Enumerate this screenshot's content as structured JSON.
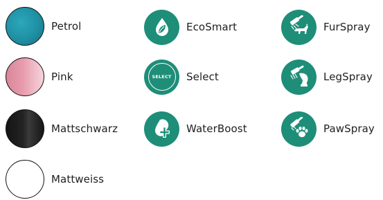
{
  "colors": {
    "petrol": "#1f8fa3",
    "pink": "#e296a7",
    "mattschwarz": "#1c1c1c",
    "mattweiss": "#ffffff",
    "feature_icon_bg": "#1e8e78"
  },
  "color_swatches": [
    {
      "label": "Petrol"
    },
    {
      "label": "Pink"
    },
    {
      "label": "Mattschwarz"
    },
    {
      "label": "Mattweiss"
    }
  ],
  "features": [
    {
      "label": "EcoSmart",
      "icon": "leaf-drop-icon"
    },
    {
      "label": "Select",
      "icon": "select-badge-icon",
      "icon_text": "SELECT"
    },
    {
      "label": "WaterBoost",
      "icon": "drop-plus-icon"
    }
  ],
  "sprays": [
    {
      "label": "FurSpray",
      "icon": "dog-shower-icon"
    },
    {
      "label": "LegSpray",
      "icon": "horse-leg-shower-icon"
    },
    {
      "label": "PawSpray",
      "icon": "paw-shower-icon"
    }
  ]
}
